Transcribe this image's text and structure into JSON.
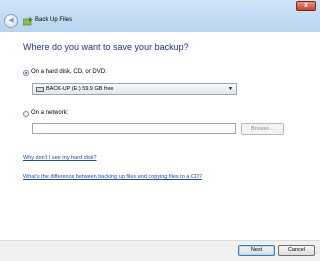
{
  "window": {
    "title": "Back Up Files",
    "close_glyph": "x",
    "back_glyph": "◀"
  },
  "heading": "Where do you want to save your backup?",
  "options": {
    "hard_disk": {
      "label": "On a hard disk, CD, or DVD:",
      "selected": true,
      "drive_value": "BACK-UP (E:)  59.9 GB free"
    },
    "network": {
      "label": "On a network:",
      "selected": false,
      "input_value": "",
      "browse_label": "Browse..."
    }
  },
  "links": {
    "hard_disk_help": "Why don't I see my hard disk?",
    "difference_help": "What's the difference between backing up files and copying files to a CD?"
  },
  "footer": {
    "next_label": "Next",
    "cancel_label": "Cancel"
  },
  "icons": {
    "back": "back-arrow-icon",
    "app": "backup-icon",
    "drive": "drive-icon",
    "dropdown": "chevron-down-icon"
  },
  "colors": {
    "heading": "#1e3287",
    "link": "#1f4ea6",
    "titlebar": "#cfe3f7",
    "close": "#c4432d"
  }
}
